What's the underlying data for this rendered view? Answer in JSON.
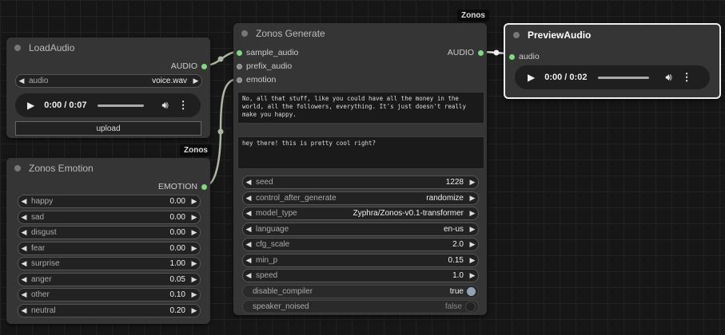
{
  "wires_label": "Zonos",
  "load_audio": {
    "title": "LoadAudio",
    "output": "AUDIO",
    "audio_widget": {
      "label": "audio",
      "value": "voice.wav"
    },
    "player": {
      "time": "0:00 / 0:07",
      "progress": 0
    },
    "upload_label": "upload"
  },
  "zonos_emotion": {
    "badge": "Zonos",
    "title": "Zonos Emotion",
    "output": "EMOTION",
    "widgets": [
      {
        "label": "happy",
        "value": "0.00"
      },
      {
        "label": "sad",
        "value": "0.00"
      },
      {
        "label": "disgust",
        "value": "0.00"
      },
      {
        "label": "fear",
        "value": "0.00"
      },
      {
        "label": "surprise",
        "value": "1.00"
      },
      {
        "label": "anger",
        "value": "0.05"
      },
      {
        "label": "other",
        "value": "0.10"
      },
      {
        "label": "neutral",
        "value": "0.20"
      }
    ]
  },
  "zonos_generate": {
    "badge": "Zonos",
    "title": "Zonos Generate",
    "inputs": [
      "sample_audio",
      "prefix_audio",
      "emotion"
    ],
    "output": "AUDIO",
    "text1": "No, all that stuff, like you could have all the money in the world, all the followers, everything. It's just doesn't really make you happy.",
    "text2": "hey there! this is pretty cool right?",
    "widgets": [
      {
        "label": "seed",
        "value": "1228"
      },
      {
        "label": "control_after_generate",
        "value": "randomize"
      },
      {
        "label": "model_type",
        "value": "Zyphra/Zonos-v0.1-transformer"
      },
      {
        "label": "language",
        "value": "en-us"
      },
      {
        "label": "cfg_scale",
        "value": "2.0"
      },
      {
        "label": "min_p",
        "value": "0.15"
      },
      {
        "label": "speed",
        "value": "1.0"
      }
    ],
    "toggles": [
      {
        "label": "disable_compiler",
        "value": "true"
      },
      {
        "label": "speaker_noised",
        "value": "false"
      }
    ]
  },
  "preview_audio": {
    "title": "PreviewAudio",
    "input": "audio",
    "player": {
      "time": "0:00 / 0:02",
      "progress": 0
    }
  }
}
